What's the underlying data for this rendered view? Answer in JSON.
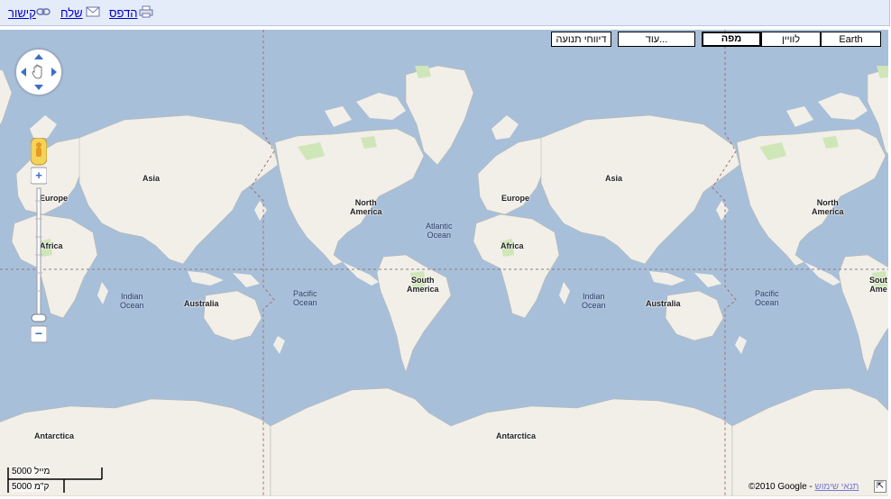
{
  "toolbar": {
    "print_label": "הדפס",
    "send_label": "שלח",
    "link_label": "קישור",
    "print_icon": "printer-icon",
    "send_icon": "envelope-icon",
    "link_icon": "chain-link-icon"
  },
  "map_types": {
    "earth": "Earth",
    "satellite": "לוויין",
    "map": "מפה",
    "more": "עוד...",
    "traffic": "דיווחי תנועה",
    "selected": "map"
  },
  "labels": {
    "asia_1": "Asia",
    "europe_1": "Europe",
    "africa_1": "Africa",
    "indian_1": [
      "Indian",
      "Ocean"
    ],
    "australia_1": "Australia",
    "antarctica_1": "Antarctica",
    "pacific_1": [
      "Pacific",
      "Ocean"
    ],
    "north_america_1": [
      "North",
      "America"
    ],
    "atlantic": [
      "Atlantic",
      "Ocean"
    ],
    "south_america_1": [
      "South",
      "America"
    ],
    "europe_2": "Europe",
    "asia_2": "Asia",
    "africa_2": "Africa",
    "indian_2": [
      "Indian",
      "Ocean"
    ],
    "australia_2": "Australia",
    "antarctica_2": "Antarctica",
    "pacific_2": [
      "Pacific",
      "Ocean"
    ],
    "north_america_2": [
      "North",
      "America"
    ],
    "south_america_2": [
      "Sout",
      "Ame"
    ]
  },
  "scale": {
    "miles": "5000 מייל",
    "km": "5000 ק\"מ"
  },
  "footer": {
    "copyright": "©2010 Google -",
    "terms": "תנאי שימוש",
    "corner_icon": "expand-arrow-icon"
  },
  "colors": {
    "ocean": "#a8bfd9",
    "land": "#f1efe8",
    "forest": "#cfe6b8",
    "border": "#8a8fa6",
    "dateline": "#a07070"
  }
}
